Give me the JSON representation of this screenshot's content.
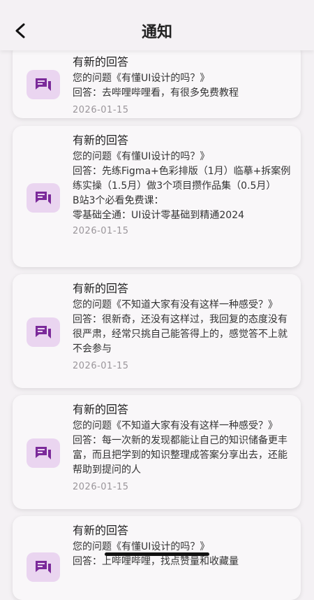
{
  "header": {
    "title": "通知"
  },
  "cards": [
    {
      "title": "有新的回答",
      "lines": [
        "您的问题《有懂UI设计的吗？》",
        "回答：去哔哩哔哩看，有很多免费教程"
      ],
      "date": "2026-01-15"
    },
    {
      "title": "有新的回答",
      "lines": [
        "您的问题《有懂UI设计的吗？》",
        "回答：先练Figma+色彩排版（1月）临摹+拆案例练实操（1.5月）做3个项目攒作品集（0.5月）",
        "B站3个必看免费课：",
        "零基础全通：UI设计零基础到精通2024"
      ],
      "date": "2026-01-15"
    },
    {
      "title": "有新的回答",
      "lines": [
        "您的问题《不知道大家有没有这样一种感受？》",
        "回答：很新奇，还没有这样过，我回复的态度没有很严肃，经常只挑自己能答得上的，感觉答不上就不会参与"
      ],
      "date": "2026-01-15"
    },
    {
      "title": "有新的回答",
      "lines": [
        "您的问题《不知道大家有没有这样一种感受？》",
        "回答：每一次新的发现都能让自己的知识储备更丰富，而且把学到的知识整理成答案分享出去，还能帮助到提问的人"
      ],
      "date": "2026-01-15"
    },
    {
      "title": "有新的回答",
      "lines": [
        "您的问题《有懂UI设计的吗？》",
        "回答：上哔哩哔哩，找点赞量和收藏量"
      ],
      "date": ""
    }
  ],
  "icons": {
    "back": "chevron-left-icon",
    "message": "chat-bubble-icon",
    "accent": "#7b2a9a",
    "icon_bg": "#ead5f0"
  }
}
